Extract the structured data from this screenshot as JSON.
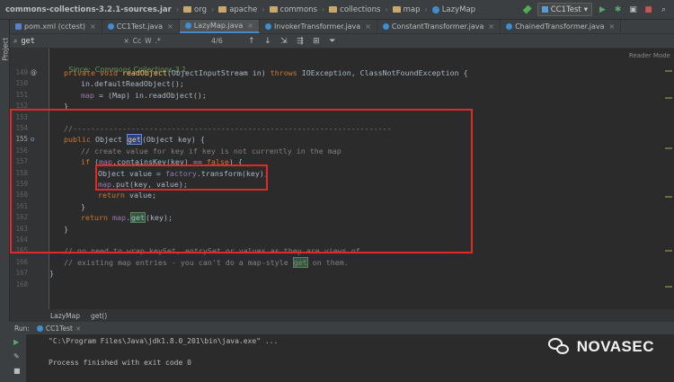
{
  "breadcrumbs": [
    "commons-collections-3.2.1-sources.jar",
    "org",
    "apache",
    "commons",
    "collections",
    "map",
    "LazyMap"
  ],
  "toolbar": {
    "run_config": "CC1Test"
  },
  "side_panel_label": "Project",
  "tabs": [
    {
      "label": "pom.xml (cctest)",
      "icon": "maven-icon",
      "active": false
    },
    {
      "label": "CC1Test.java",
      "icon": "class-icon",
      "active": false
    },
    {
      "label": "LazyMap.java",
      "icon": "class-icon",
      "active": true
    },
    {
      "label": "InvokerTransformer.java",
      "icon": "class-icon",
      "active": false
    },
    {
      "label": "ConstantTransformer.java",
      "icon": "class-icon",
      "active": false
    },
    {
      "label": "ChainedTransformer.java",
      "icon": "class-icon",
      "active": false
    }
  ],
  "search": {
    "value": "get",
    "options": [
      "Cc",
      "W",
      ".*"
    ],
    "match_count": "4/6"
  },
  "editor": {
    "reader_mode": "Reader Mode",
    "lines": [
      {
        "num": "",
        "text": "Since:  Commons Collections 3.1"
      },
      {
        "num": "149",
        "text": "private void readObject(ObjectInputStream in) throws IOException, ClassNotFoundException {"
      },
      {
        "num": "150",
        "text": "in.defaultReadObject();"
      },
      {
        "num": "151",
        "text": "map = (Map) in.readObject();"
      },
      {
        "num": "152",
        "text": "}"
      },
      {
        "num": "153",
        "text": ""
      },
      {
        "num": "154",
        "text": "//-----------------------------------------------------------------------"
      },
      {
        "num": "155",
        "text": "public Object get(Object key) {"
      },
      {
        "num": "156",
        "text": "// create value for key if key is not currently in the map"
      },
      {
        "num": "157",
        "text": "if (map.containsKey(key) == false) {"
      },
      {
        "num": "158",
        "text": "Object value = factory.transform(key);"
      },
      {
        "num": "159",
        "text": "map.put(key, value);"
      },
      {
        "num": "160",
        "text": "return value;"
      },
      {
        "num": "161",
        "text": "}"
      },
      {
        "num": "162",
        "text": "return map.get(key);"
      },
      {
        "num": "163",
        "text": "}"
      },
      {
        "num": "164",
        "text": ""
      },
      {
        "num": "165",
        "text": "// no need to wrap keySet, entrySet or values as they are views of"
      },
      {
        "num": "166",
        "text": "// existing map entries - you can't do a map-style get on them."
      },
      {
        "num": "167",
        "text": "}"
      },
      {
        "num": "168",
        "text": ""
      }
    ]
  },
  "structure_crumbs": [
    "LazyMap",
    "get()"
  ],
  "run": {
    "label": "Run:",
    "tab": "CC1Test",
    "output": [
      "\"C:\\Program Files\\Java\\jdk1.8.0_201\\bin\\java.exe\" ...",
      "",
      "Process finished with exit code 0"
    ]
  },
  "watermark": "NOVASEC"
}
